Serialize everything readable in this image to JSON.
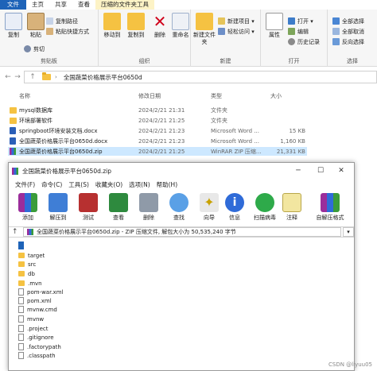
{
  "ribbon": {
    "tabs": [
      "文件",
      "主页",
      "共享",
      "查看",
      "压缩的文件夹工具"
    ],
    "clipboard": {
      "label": "剪贴板",
      "pin": "固定到快速访问",
      "copy": "复制",
      "paste": "粘贴",
      "copy_path": "复制路径",
      "paste_shortcut": "粘贴快捷方式",
      "cut": "剪切"
    },
    "organize": {
      "label": "组织",
      "move_to": "移动到",
      "copy_to": "复制到",
      "delete": "删除",
      "rename": "重命名"
    },
    "new": {
      "label": "新建",
      "new_folder": "新建文件夹",
      "new_item": "新建项目 ▾",
      "easy_access": "轻松访问 ▾"
    },
    "open": {
      "label": "打开",
      "properties": "属性",
      "open": "打开 ▾",
      "edit": "编辑",
      "history": "历史记录"
    },
    "select": {
      "label": "选择",
      "select_all": "全部选择",
      "select_none": "全部取消",
      "invert": "反向选择"
    }
  },
  "address": {
    "path": "全国蔬菜价格展示平台0650d",
    "separator": "›"
  },
  "columns": {
    "name": "名称",
    "date": "修改日期",
    "type": "类型",
    "size": "大小"
  },
  "files": [
    {
      "name": "mysql数据库",
      "date": "2024/2/21 21:31",
      "type": "文件夹",
      "size": "",
      "kind": "folder"
    },
    {
      "name": "环境部署软件",
      "date": "2024/2/21 21:25",
      "type": "文件夹",
      "size": "",
      "kind": "folder"
    },
    {
      "name": "springboot环境安装文档.docx",
      "date": "2024/2/21 21:23",
      "type": "Microsoft Word ...",
      "size": "15 KB",
      "kind": "doc"
    },
    {
      "name": "全国蔬菜价格展示平台0650d.docx",
      "date": "2024/2/21 21:23",
      "type": "Microsoft Word ...",
      "size": "1,160 KB",
      "kind": "doc"
    },
    {
      "name": "全国蔬菜价格展示平台0650d.zip",
      "date": "2024/2/21 21:25",
      "type": "WinRAR ZIP 压缩...",
      "size": "21,331 KB",
      "kind": "zip"
    }
  ],
  "winrar": {
    "title": "全国蔬菜价格展示平台0650d.zip",
    "menu": [
      "文件(F)",
      "命令(C)",
      "工具(S)",
      "收藏夹(O)",
      "选项(N)",
      "帮助(H)"
    ],
    "toolbar": [
      "添加",
      "解压到",
      "测试",
      "查看",
      "删除",
      "查找",
      "向导",
      "信息",
      "扫描病毒",
      "注释",
      "自解压格式"
    ],
    "path": "全国蔬菜价格展示平台0650d.zip - ZIP 压缩文件, 解包大小为 50,535,240 字节",
    "items": [
      {
        "name": "",
        "kind": "up"
      },
      {
        "name": "target",
        "kind": "folder"
      },
      {
        "name": "src",
        "kind": "folder"
      },
      {
        "name": "db",
        "kind": "folder"
      },
      {
        "name": ".mvn",
        "kind": "folder"
      },
      {
        "name": "pom-war.xml",
        "kind": "file"
      },
      {
        "name": "pom.xml",
        "kind": "file"
      },
      {
        "name": "mvnw.cmd",
        "kind": "file"
      },
      {
        "name": "mvnw",
        "kind": "file"
      },
      {
        "name": ".project",
        "kind": "file"
      },
      {
        "name": ".gitignore",
        "kind": "file"
      },
      {
        "name": ".factorypath",
        "kind": "file"
      },
      {
        "name": ".classpath",
        "kind": "file"
      }
    ]
  },
  "watermark": "CSDN @liyuu05"
}
